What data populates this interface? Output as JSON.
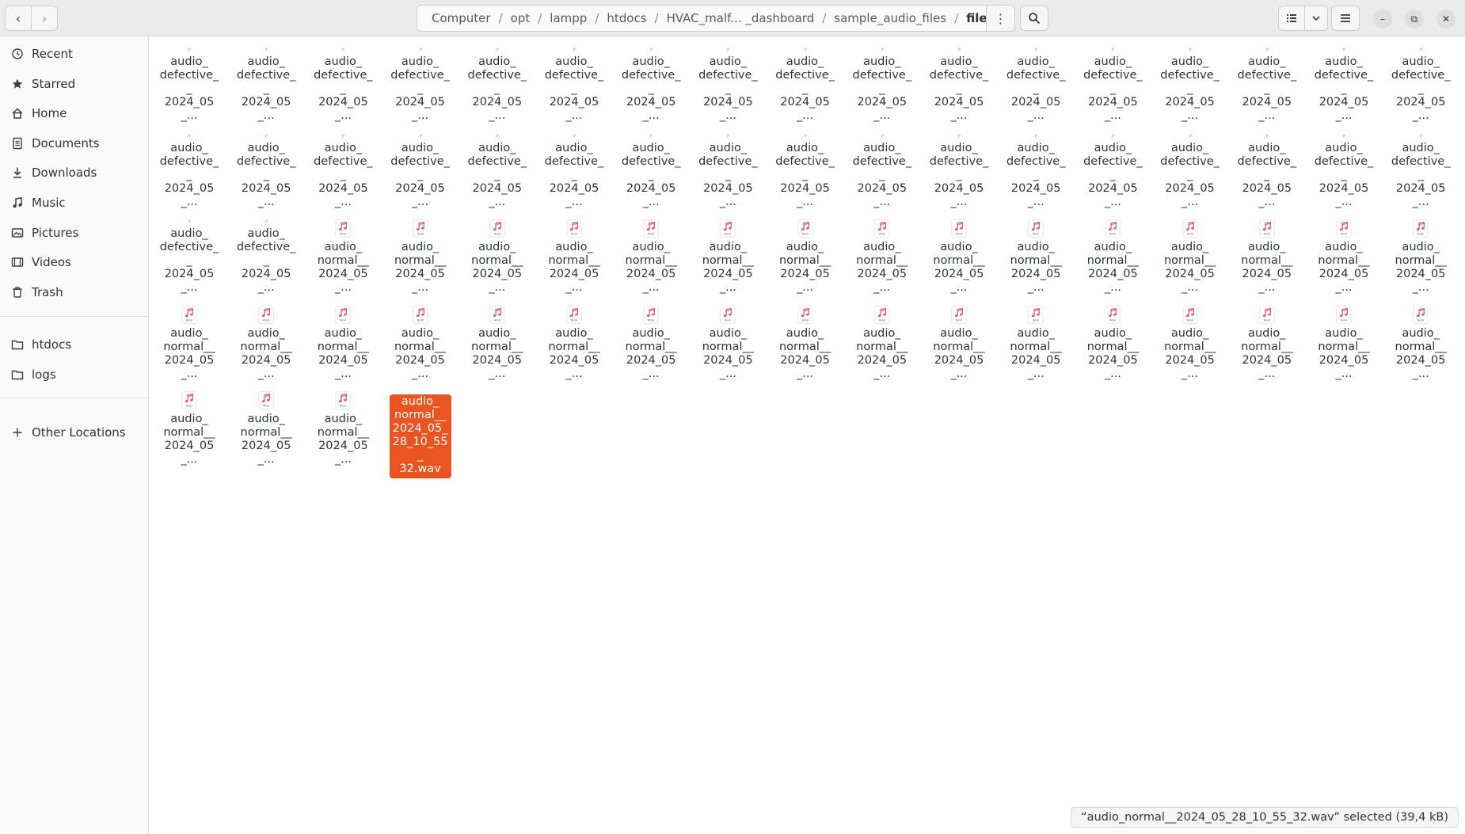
{
  "header": {
    "breadcrumbs": [
      "Computer",
      "opt",
      "lampp",
      "htdocs",
      "HVAC_malf... _dashboard",
      "sample_audio_files",
      "files"
    ],
    "separator": "/"
  },
  "sidebar": {
    "items": [
      {
        "label": "Recent",
        "icon": "clock-icon"
      },
      {
        "label": "Starred",
        "icon": "star-icon"
      },
      {
        "label": "Home",
        "icon": "home-icon"
      },
      {
        "label": "Documents",
        "icon": "document-icon"
      },
      {
        "label": "Downloads",
        "icon": "download-icon"
      },
      {
        "label": "Music",
        "icon": "music-icon"
      },
      {
        "label": "Pictures",
        "icon": "picture-icon"
      },
      {
        "label": "Videos",
        "icon": "video-icon"
      },
      {
        "label": "Trash",
        "icon": "trash-icon"
      }
    ],
    "bookmarks": [
      {
        "label": "htdocs",
        "icon": "folder-icon"
      },
      {
        "label": "logs",
        "icon": "folder-icon"
      }
    ],
    "other_locations": {
      "label": "Other Locations",
      "icon": "plus-icon"
    }
  },
  "files": {
    "icon_badge": "wav",
    "accent_color": "#e95420",
    "items": [
      "audio_\ndefective__\n2024_05_...",
      "audio_\ndefective__\n2024_05_...",
      "audio_\ndefective__\n2024_05_...",
      "audio_\ndefective__\n2024_05_...",
      "audio_\ndefective__\n2024_05_...",
      "audio_\ndefective__\n2024_05_...",
      "audio_\ndefective__\n2024_05_...",
      "audio_\ndefective__\n2024_05_...",
      "audio_\ndefective__\n2024_05_...",
      "audio_\ndefective__\n2024_05_...",
      "audio_\ndefective__\n2024_05_...",
      "audio_\ndefective__\n2024_05_...",
      "audio_\ndefective__\n2024_05_...",
      "audio_\ndefective__\n2024_05_...",
      "audio_\ndefective__\n2024_05_...",
      "audio_\ndefective__\n2024_05_...",
      "audio_\ndefective__\n2024_05_...",
      "audio_\ndefective__\n2024_05_...",
      "audio_\ndefective__\n2024_05_...",
      "audio_\ndefective__\n2024_05_...",
      "audio_\ndefective__\n2024_05_...",
      "audio_\ndefective__\n2024_05_...",
      "audio_\ndefective__\n2024_05_...",
      "audio_\ndefective__\n2024_05_...",
      "audio_\ndefective__\n2024_05_...",
      "audio_\ndefective__\n2024_05_...",
      "audio_\ndefective__\n2024_05_...",
      "audio_\ndefective__\n2024_05_...",
      "audio_\ndefective__\n2024_05_...",
      "audio_\ndefective__\n2024_05_...",
      "audio_\ndefective__\n2024_05_...",
      "audio_\ndefective__\n2024_05_...",
      "audio_\ndefective__\n2024_05_...",
      "audio_\ndefective__\n2024_05_...",
      "audio_\ndefective__\n2024_05_...",
      "audio_\ndefective__\n2024_05_...",
      "audio_\nnormal__\n2024_05_...",
      "audio_\nnormal__\n2024_05_...",
      "audio_\nnormal__\n2024_05_...",
      "audio_\nnormal__\n2024_05_...",
      "audio_\nnormal__\n2024_05_...",
      "audio_\nnormal__\n2024_05_...",
      "audio_\nnormal__\n2024_05_...",
      "audio_\nnormal__\n2024_05_...",
      "audio_\nnormal__\n2024_05_...",
      "audio_\nnormal__\n2024_05_...",
      "audio_\nnormal__\n2024_05_...",
      "audio_\nnormal__\n2024_05_...",
      "audio_\nnormal__\n2024_05_...",
      "audio_\nnormal__\n2024_05_...",
      "audio_\nnormal__\n2024_05_...",
      "audio_\nnormal__\n2024_05_...",
      "audio_\nnormal__\n2024_05_...",
      "audio_\nnormal__\n2024_05_...",
      "audio_\nnormal__\n2024_05_...",
      "audio_\nnormal__\n2024_05_...",
      "audio_\nnormal__\n2024_05_...",
      "audio_\nnormal__\n2024_05_...",
      "audio_\nnormal__\n2024_05_...",
      "audio_\nnormal__\n2024_05_...",
      "audio_\nnormal__\n2024_05_...",
      "audio_\nnormal__\n2024_05_...",
      "audio_\nnormal__\n2024_05_...",
      "audio_\nnormal__\n2024_05_...",
      "audio_\nnormal__\n2024_05_...",
      "audio_\nnormal__\n2024_05_...",
      "audio_\nnormal__\n2024_05_...",
      "audio_\nnormal__\n2024_05_...",
      "audio_\nnormal__\n2024_05_...",
      "audio_\nnormal__\n2024_05_...",
      "audio_\nnormal__\n2024_05_...",
      "audio_\nnormal__\n2024_05_\n28_10_55_\n32.wav"
    ],
    "selected_index": 71
  },
  "status": {
    "text": "“audio_normal__2024_05_28_10_55_32.wav” selected  (39,4 kB)"
  }
}
